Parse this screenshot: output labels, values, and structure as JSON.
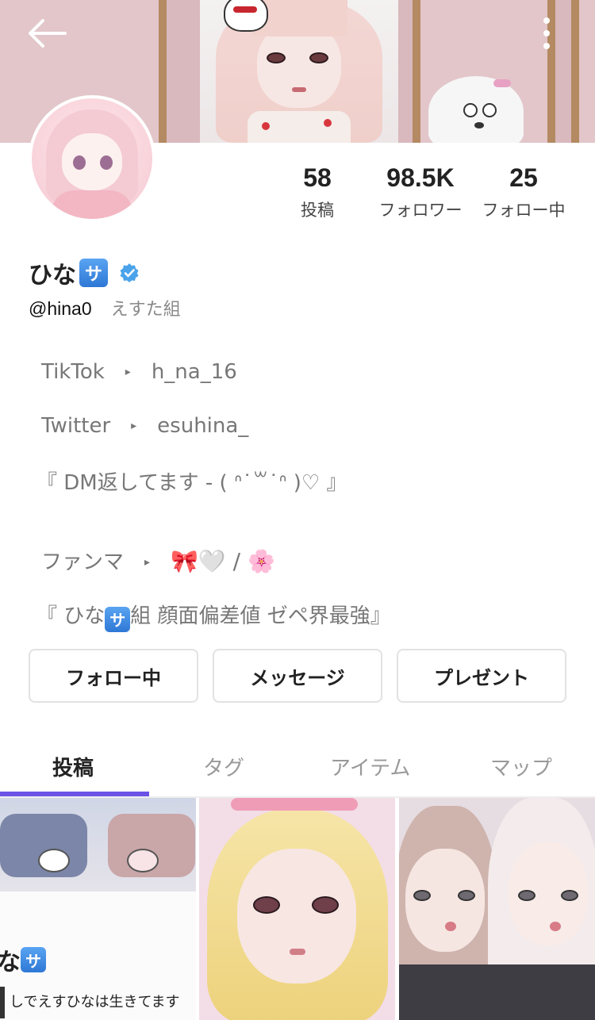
{
  "header": {
    "back_icon": "arrow-left-icon",
    "more_icon": "vertical-dots-icon"
  },
  "profile": {
    "name": "ひな",
    "name_badge": "サ",
    "verified_icon": "verified-check-icon",
    "handle": "@hina0",
    "group": "えすた組"
  },
  "stats": [
    {
      "value": "58",
      "label": "投稿"
    },
    {
      "value": "98.5K",
      "label": "フォロワー"
    },
    {
      "value": "25",
      "label": "フォロー中"
    }
  ],
  "bio": {
    "tiktok_label": "TikTok",
    "tiktok_value": "h_na_16",
    "twitter_label": "Twitter",
    "twitter_value": "esuhina_",
    "dm_line": "『 DM返してます - ( ᐢ˙꒳​˙ᐢ )♡ 』",
    "fanma_label": "ファンマ",
    "fanma_emojis": "🎀🤍 / 🌸",
    "motto_prefix": "『 ひな",
    "motto_badge": "サ",
    "motto_suffix": "組 顔面偏差値 ゼペ界最強』",
    "arrow_glyph": "▸"
  },
  "actions": {
    "following_label": "フォロー中",
    "message_label": "メッセージ",
    "gift_label": "プレゼント"
  },
  "tabs": [
    {
      "label": "投稿",
      "active": true
    },
    {
      "label": "タグ",
      "active": false
    },
    {
      "label": "アイテム",
      "active": false
    },
    {
      "label": "マップ",
      "active": false
    }
  ],
  "posts": {
    "first_caption_name": "な",
    "first_caption_badge": "サ",
    "first_caption_line": "しでえすひなは生きてます"
  },
  "colors": {
    "tab_indicator": "#6d52e6",
    "verified_blue": "#4aa3ea",
    "badge_blue": "#2e78d6"
  }
}
